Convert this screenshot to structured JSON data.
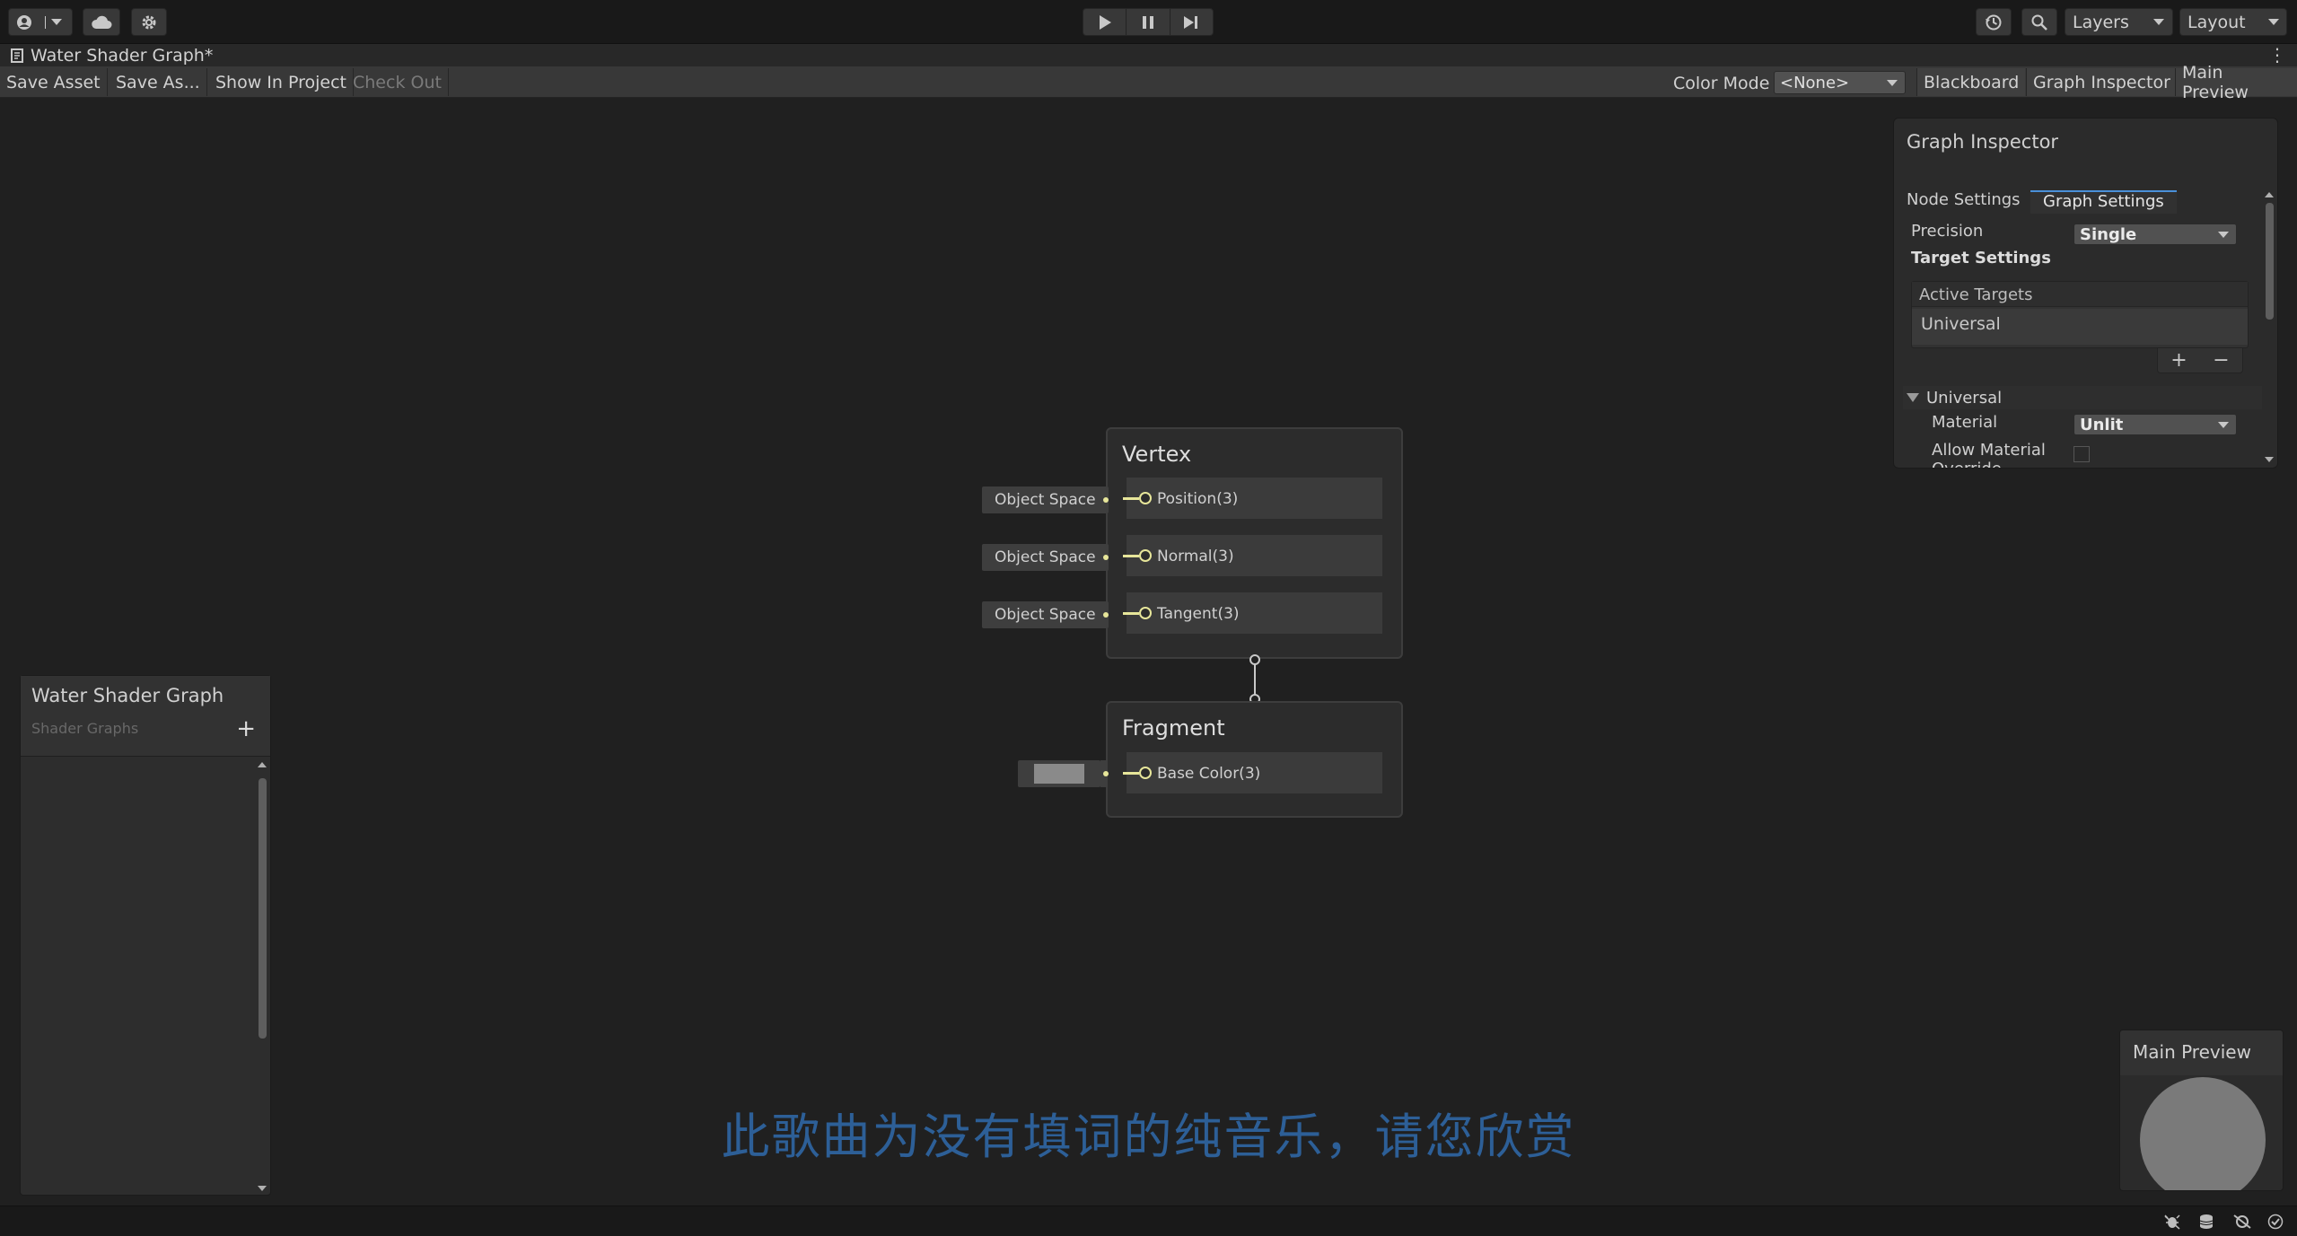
{
  "toolbar": {
    "account_icon": "account-icon",
    "cloud_icon": "cloud-icon",
    "settings_icon": "gear-icon",
    "play_icon": "play-icon",
    "pause_icon": "pause-icon",
    "step_icon": "step-icon",
    "history_icon": "history-icon",
    "search_icon": "search-icon",
    "layers_label": "Layers",
    "layout_label": "Layout"
  },
  "window": {
    "tab_title": "Water Shader Graph*"
  },
  "graph_toolbar": {
    "save_asset": "Save Asset",
    "save_as": "Save As...",
    "show_in_project": "Show In Project",
    "check_out": "Check Out",
    "color_mode_label": "Color Mode",
    "color_mode_value": "<None>",
    "blackboard": "Blackboard",
    "graph_inspector": "Graph Inspector",
    "main_preview": "Main Preview"
  },
  "inspector": {
    "title": "Graph Inspector",
    "tabs": [
      "Node Settings",
      "Graph Settings"
    ],
    "precision_label": "Precision",
    "precision_value": "Single",
    "target_settings_label": "Target Settings",
    "active_targets_label": "Active Targets",
    "active_targets": [
      "Universal"
    ],
    "add_label": "+",
    "remove_label": "−",
    "universal_fold": "Universal",
    "material_label": "Material",
    "material_value": "Unlit",
    "allow_material_label": "Allow Material",
    "allow_material_cut": "Override"
  },
  "vertex_node": {
    "title": "Vertex",
    "ports": [
      {
        "label": "Position(3)",
        "input": "Object Space"
      },
      {
        "label": "Normal(3)",
        "input": "Object Space"
      },
      {
        "label": "Tangent(3)",
        "input": "Object Space"
      }
    ]
  },
  "fragment_node": {
    "title": "Fragment",
    "ports": [
      {
        "label": "Base Color(3)",
        "input_color": "#8a8a8a"
      }
    ]
  },
  "blackboard": {
    "title": "Water Shader Graph",
    "subtitle": "Shader Graphs",
    "add_label": "+"
  },
  "preview": {
    "title": "Main Preview"
  },
  "subtitle_overlay": "此歌曲为没有填词的纯音乐，请您欣赏",
  "colors": {
    "accent": "#4a90d9",
    "port": "#e7e69a",
    "subtitle": "#2d5f97"
  }
}
